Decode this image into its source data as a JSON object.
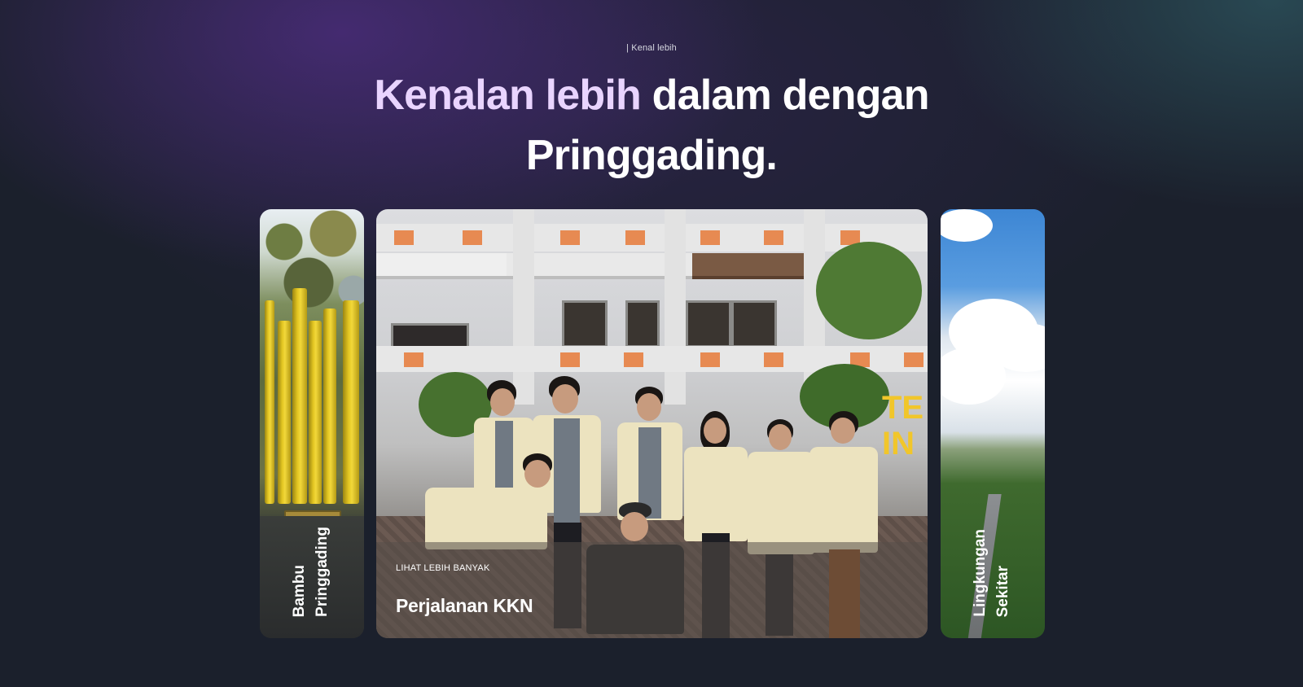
{
  "header": {
    "eyebrow": "| Kenal lebih",
    "headline_accent": "Kenalan lebih",
    "headline_rest": "dalam dengan",
    "headline_line2": "Pringgading."
  },
  "gallery": {
    "left_card": {
      "label_line1": "Bambu",
      "label_line2": "Pringgading"
    },
    "main_card": {
      "eyebrow": "LIHAT LEBIH BANYAK",
      "title": "Perjalanan KKN",
      "sign_text": "TE\nIN"
    },
    "right_card": {
      "label_line1": "Lingkungan",
      "label_line2": "Sekitar"
    }
  },
  "colors": {
    "background": "#1b202c",
    "accent_text": "#e9d4ff",
    "headline": "#ffffff"
  }
}
